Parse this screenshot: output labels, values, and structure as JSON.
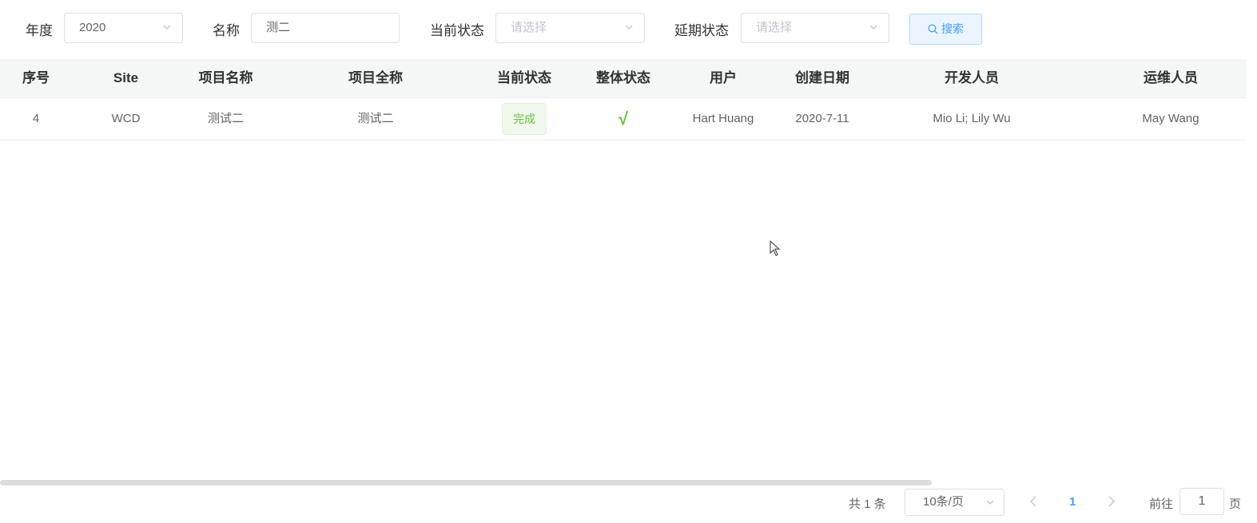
{
  "filters": {
    "year_label": "年度",
    "year_value": "2020",
    "name_label": "名称",
    "name_value": "测二",
    "current_status_label": "当前状态",
    "current_status_placeholder": "请选择",
    "delay_status_label": "延期状态",
    "delay_status_placeholder": "请选择",
    "search_label": "搜索"
  },
  "table": {
    "columns": [
      "序号",
      "Site",
      "项目名称",
      "项目全称",
      "当前状态",
      "整体状态",
      "用户",
      "创建日期",
      "开发人员",
      "运维人员"
    ],
    "rows": [
      {
        "index": "4",
        "site": "WCD",
        "name": "测试二",
        "full_name": "测试二",
        "current_status": "完成",
        "overall_status": "√",
        "user": "Hart Huang",
        "created": "2020-7-11",
        "developers": "Mio Li; Lily Wu",
        "ops": "May Wang"
      }
    ]
  },
  "pagination": {
    "total": "共 1 条",
    "page_size": "10条/页",
    "current_page": "1",
    "goto_label": "前往",
    "goto_value": "1",
    "page_suffix": "页"
  },
  "colors": {
    "primary": "#409eff",
    "success": "#67c23a",
    "header_bg": "#f5f7f6"
  }
}
